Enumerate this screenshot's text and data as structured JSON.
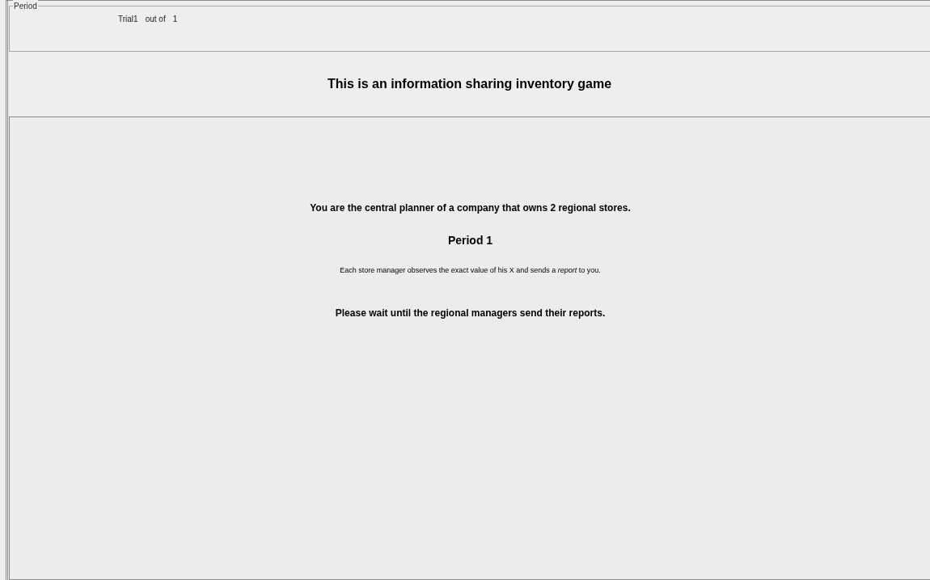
{
  "period_group": {
    "legend": "Period",
    "trial_label": "Trial1",
    "out_of_label": "out of",
    "total": "1"
  },
  "title": "This is an information sharing inventory game",
  "main_panel": {
    "role_text": "You are the central planner of a company that owns 2 regional stores.",
    "period_heading": "Period 1",
    "instruction": "Each store manager observes the exact value of his X and sends a *report* to you.",
    "status_text": "Please wait until the regional managers send their reports."
  }
}
